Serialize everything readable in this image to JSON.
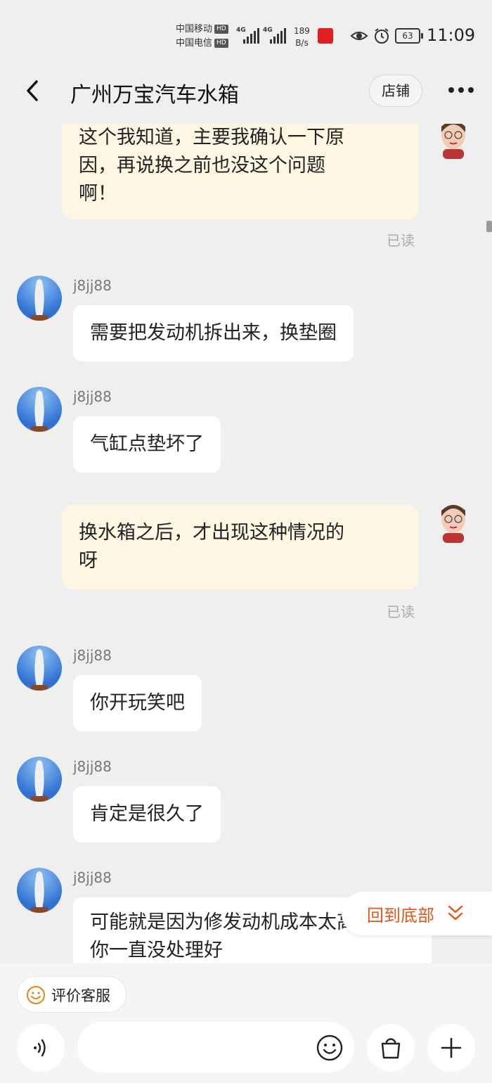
{
  "status_bar": {
    "carrier1": "中国移动",
    "carrier2": "中国电信",
    "hd": "HD",
    "net1": "4G",
    "net2": "4G",
    "speed_value": "189",
    "speed_unit": "B/s",
    "battery": "63",
    "time": "11:09"
  },
  "header": {
    "title": "广州万宝汽车水箱",
    "shop_button": "店铺"
  },
  "messages": [
    {
      "from": "me",
      "lines": [
        "这个我知道，主要我确认一下原",
        "因，再说换之前也没这个问题",
        "啊！"
      ],
      "status": "已读"
    },
    {
      "from": "seller",
      "name": "j8jj88",
      "text": "需要把发动机拆出来，换垫圈"
    },
    {
      "from": "seller",
      "name": "j8jj88",
      "text": "气缸点垫坏了"
    },
    {
      "from": "me",
      "lines": [
        "换水箱之后，才出现这种情况的",
        "呀"
      ],
      "status": "已读"
    },
    {
      "from": "seller",
      "name": "j8jj88",
      "text": "你开玩笑吧"
    },
    {
      "from": "seller",
      "name": "j8jj88",
      "text": "肯定是很久了"
    },
    {
      "from": "seller",
      "name": "j8jj88",
      "lines": [
        "可能就是因为修发动机成本太高",
        "你一直没处理好"
      ]
    }
  ],
  "back_to_bottom": "回到底部",
  "bottom_bar": {
    "rate_button": "评价客服",
    "input_value": ""
  },
  "colors": {
    "accent": "#e5561a",
    "outgoing_bubble": "#fdf6e3",
    "incoming_bubble": "#ffffff",
    "background": "#efefef"
  }
}
